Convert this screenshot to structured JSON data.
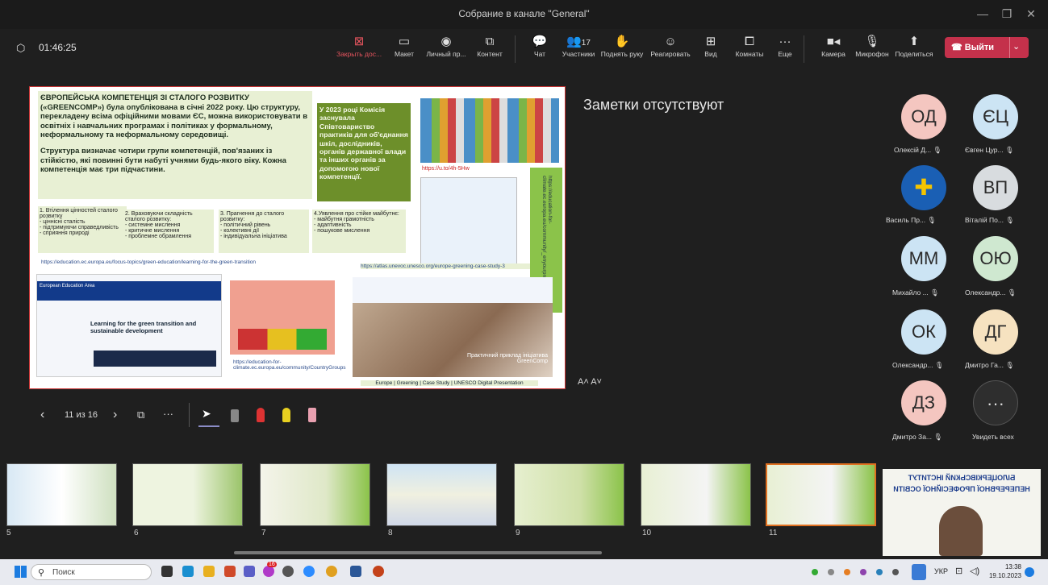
{
  "window": {
    "title": "Собрание в канале \"General\""
  },
  "meeting": {
    "timer": "01:46:25"
  },
  "toolbar": {
    "stop_share": "Закрыть дос...",
    "layout": "Макет",
    "personal": "Личный пр...",
    "content": "Контент",
    "chat": "Чат",
    "participants": "Участники",
    "participants_count": "17",
    "raise_hand": "Поднять руку",
    "react": "Реагировать",
    "view": "Вид",
    "rooms": "Комнаты",
    "more": "Еще",
    "camera": "Камера",
    "mic": "Микрофон",
    "share": "Поделиться",
    "leave": "Выйти"
  },
  "slide": {
    "heading": "ЄВРОПЕЙСЬКА КОМПЕТЕНЦІЯ ЗІ СТАЛОГО РОЗВИТКУ («GREENCOMP») була опублікована в січні 2022 року. Цю структуру, перекладену всіма офіційними мовами ЄС, можна використовувати в освітніх і навчальних програмах і політиках у формальному, неформальному та неформальному середовищі.",
    "para2": "Структура визначає чотири групи компетенцій, пов'язаних із стійкістю, які повинні бути набуті учнями будь-якого віку. Кожна компетенція має три підчастини.",
    "commission": "У 2023 році Комісія заснувала Співтовариство практиків для об'єднання шкіл, дослідників, органів державної влади та інших органів за допомогою нової компетенції.",
    "groups": [
      {
        "title": "1. Втілення цінностей сталого розвитку",
        "items": "- ціннісні сталість\n- підтримуючи справедливість\n- сприяння природі"
      },
      {
        "title": "2. Враховуючи складність сталого розвитку:",
        "items": "- системне мислення\n- критичне мислення\n- проблемне обрамлення"
      },
      {
        "title": "3. Прагнення до сталого розвитку:",
        "items": "- політичний рівень\n- колективні дії\n- індивідуальна ініціатива"
      },
      {
        "title": "4.Уявлення про стійке майбутнє:",
        "items": "- майбутня грамотність\n- адаптивність\n- пошукове мислення"
      }
    ],
    "link1": "https://education.ec.europa.eu/focus-topics/green-education/learning-for-the-green-transition",
    "link2": "https://atlas.unevoc.unesco.org/europe-greening-case-study-3",
    "short_link": "https://u.to/4h-5Hw",
    "vertical_link": "https://education-for-climate.ec.europa.eu/community/_enyourprofile",
    "community_link": "https://education-for-climate.ec.europa.eu/community/CountryGroups",
    "eea_title": "European Education Area",
    "eea_heading": "Learning for the green transition and sustainable development",
    "photo_caption": "Практичний приклад ініціатива GreenComp",
    "footer": "Europe | Greening | Case Study | UNESCO Digital Presentation"
  },
  "notes": "Заметки отсутствуют",
  "slide_controls": {
    "page": "11 из 16",
    "font": "A˄ A˅"
  },
  "participants": [
    {
      "initials": "ОД",
      "name": "Олексій Д...",
      "color": "#f4c6c0"
    },
    {
      "initials": "ЄЦ",
      "name": "Євген Цур...",
      "color": "#cce4f4"
    },
    {
      "initials": "",
      "name": "Василь Пр...",
      "color": "#1a5fb4"
    },
    {
      "initials": "ВП",
      "name": "Віталій По...",
      "color": "#d8dcdf"
    },
    {
      "initials": "ММ",
      "name": "Михайло ...",
      "color": "#cce4f4"
    },
    {
      "initials": "ОЮ",
      "name": "Олександр...",
      "color": "#cfe8d0"
    },
    {
      "initials": "ОК",
      "name": "Олександр...",
      "color": "#cce4f4"
    },
    {
      "initials": "ДГ",
      "name": "Дмитро Га...",
      "color": "#f6e2c0"
    },
    {
      "initials": "ДЗ",
      "name": "Дмитро За...",
      "color": "#f4c6c0"
    },
    {
      "initials": "···",
      "name": "Увидеть всех",
      "color": "#2e2e2e"
    }
  ],
  "thumbnails": [
    "5",
    "6",
    "7",
    "8",
    "9",
    "10",
    "11"
  ],
  "video_banner": {
    "line1": "БІЛОЦЕРКІВСЬКИЙ ІНСТИТУТ",
    "line2": "НЕПЕРЕРВНОЇ ПРОФЕСІЙНОЇ ОСВІТИ"
  },
  "taskbar": {
    "search": "Поиск",
    "lang": "УКР",
    "time": "13:38",
    "date": "19.10.2023",
    "badge": "16"
  }
}
